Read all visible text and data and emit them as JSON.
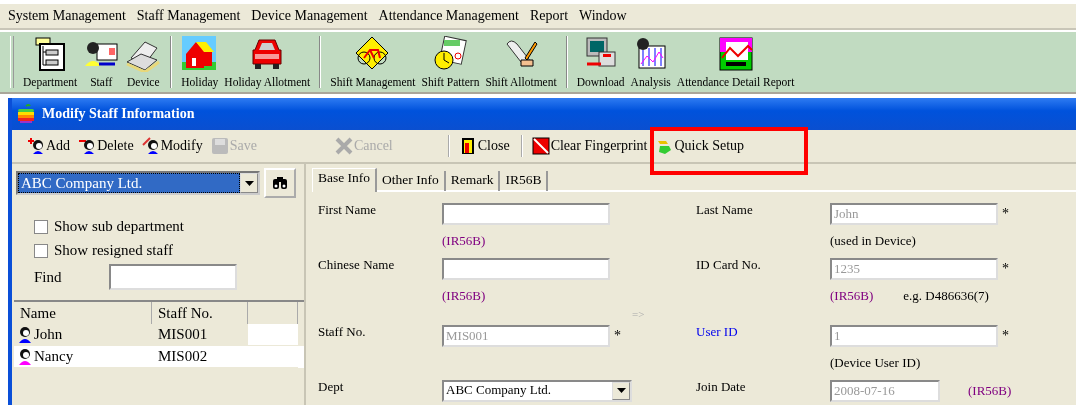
{
  "menu": [
    "System Management",
    "Staff Management",
    "Device Management",
    "Attendance Management",
    "Report",
    "Window"
  ],
  "toolbar": [
    [
      {
        "label": "Department"
      },
      {
        "label": "Staff"
      },
      {
        "label": "Device"
      }
    ],
    [
      {
        "label": "Holiday"
      },
      {
        "label": "Holiday Allotment"
      }
    ],
    [
      {
        "label": "Shift Management"
      },
      {
        "label": "Shift Pattern"
      },
      {
        "label": "Shift Allotment"
      }
    ],
    [
      {
        "label": "Download"
      },
      {
        "label": "Analysis"
      },
      {
        "label": "Attendance Detail Report"
      }
    ]
  ],
  "window": {
    "title": "Modify Staff Information",
    "actions": [
      [
        {
          "label": "Add",
          "disabled": false,
          "highlighted": false
        },
        {
          "label": "Delete",
          "disabled": false,
          "highlighted": false
        },
        {
          "label": "Modify",
          "disabled": false,
          "highlighted": false
        },
        {
          "label": "Save",
          "disabled": true,
          "highlighted": false
        },
        {
          "label": "Cancel",
          "disabled": true,
          "highlighted": false
        }
      ],
      [
        {
          "label": "Close",
          "disabled": false,
          "highlighted": false
        }
      ],
      [
        {
          "label": "Clear Fingerprint",
          "disabled": false,
          "highlighted": false
        },
        {
          "label": "Quick Setup",
          "disabled": false,
          "highlighted": true
        }
      ]
    ],
    "department": {
      "value": "ABC Company Ltd."
    },
    "options": [
      {
        "label": "Show sub department",
        "checked": false
      },
      {
        "label": "Show resigned staff",
        "checked": false
      }
    ],
    "find": {
      "label": "Find"
    },
    "staff_table": {
      "columns": [
        "Name",
        "Staff No."
      ],
      "rows": [
        {
          "name": "John",
          "staff_no": "MIS001",
          "selected": true,
          "color": "#0000ff"
        },
        {
          "name": "Nancy",
          "staff_no": "MIS002",
          "selected": false,
          "color": "#ff00ff"
        }
      ]
    },
    "tabs": [
      {
        "label": "Base Info",
        "selected": true
      },
      {
        "label": "Other Info",
        "selected": false
      },
      {
        "label": "Remark",
        "selected": false
      },
      {
        "label": "IR56B",
        "selected": false
      }
    ],
    "form_rows": [
      {
        "kind": "fields",
        "left": {
          "label": "First Name"
        },
        "right": {
          "label": "Last Name",
          "value": "John",
          "disabled": true,
          "required_mark": "*"
        }
      },
      {
        "kind": "hints",
        "left": [
          {
            "text": "(IR56B)",
            "kind": "ir56b"
          }
        ],
        "right": [
          {
            "text": "(used in Device)",
            "kind": "note"
          }
        ]
      },
      {
        "kind": "fields",
        "left": {
          "label": "Chinese Name"
        },
        "right": {
          "label": "ID Card No.",
          "value": "1235",
          "disabled": true,
          "required_mark": "*"
        }
      },
      {
        "kind": "hints",
        "left": [
          {
            "text": "(IR56B)",
            "kind": "ir56b"
          }
        ],
        "right": [
          {
            "text": "(IR56B)",
            "kind": "ir56b"
          },
          {
            "text": "e.g. D486636(7)",
            "kind": "note"
          }
        ]
      },
      {
        "kind": "arrow",
        "text": "=>"
      },
      {
        "kind": "fields",
        "left": {
          "label": "Staff No.",
          "value": "MIS001",
          "disabled": true,
          "required_mark": "*"
        },
        "right": {
          "label": "User ID",
          "value": "1",
          "disabled": true,
          "required_mark": "*",
          "emphasis": true
        }
      },
      {
        "kind": "hints",
        "right": [
          {
            "text": "(Device User ID)",
            "kind": "note"
          }
        ]
      },
      {
        "kind": "fields",
        "left": {
          "label": "Dept",
          "value": "ABC Company Ltd.",
          "dropdown": true
        },
        "right": {
          "label": "Join Date",
          "value": "2008-07-16",
          "disabled": true,
          "short": true,
          "after": {
            "text": "(IR56B)",
            "kind": "ir56b"
          }
        }
      }
    ]
  }
}
